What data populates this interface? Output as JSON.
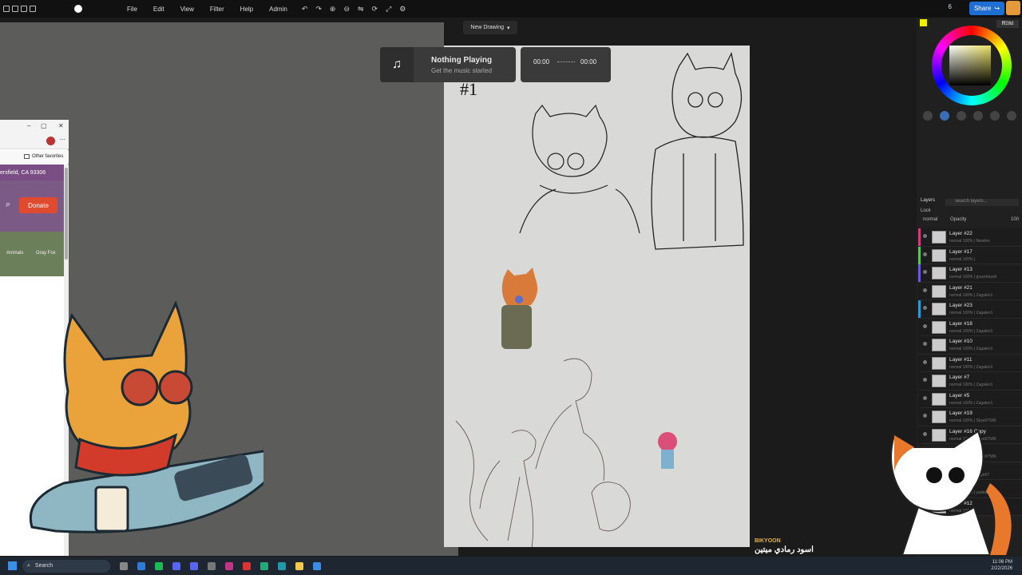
{
  "menu": [
    "File",
    "Edit",
    "View",
    "Filter",
    "Help",
    "Admin"
  ],
  "toolbar_icons": [
    "undo-icon",
    "redo-icon",
    "zoom-in-icon",
    "zoom-out-icon",
    "flip-icon",
    "rotate-icon",
    "fullscreen-icon",
    "settings-icon"
  ],
  "share_label": "Share",
  "viewer_count": "6",
  "document_title": "New Drawing",
  "music": {
    "title": "Nothing Playing",
    "subtitle": "Get the music started",
    "time_start": "00:00",
    "time_end": "00:00"
  },
  "browser": {
    "favorites": "Other favorites",
    "address": "ersfield, CA 93306",
    "donate": "Donate",
    "crumb1": "Animals",
    "crumb2": "Gray Fox"
  },
  "color_hex": "fff28d",
  "layers_panel": {
    "title": "Layers",
    "search_placeholder": "search layers...",
    "lock": "Lock",
    "blend": "normal",
    "opacity_label": "Opacity",
    "opacity": "100"
  },
  "layers": [
    {
      "name": "Layer #22",
      "meta": "normal 100% | Newton",
      "edge": "#d33c7a"
    },
    {
      "name": "Layer #17",
      "meta": "normal 100% |",
      "edge": "#5fc25f"
    },
    {
      "name": "Layer #13",
      "meta": "normal 100% | gracefulash",
      "edge": "#6a5ad8"
    },
    {
      "name": "Layer #21",
      "meta": "normal 100% | Zagalen1",
      "edge": "#1c1c1c"
    },
    {
      "name": "Layer #23",
      "meta": "normal 100% | Zagalen1",
      "edge": "#2e9ad0"
    },
    {
      "name": "Layer #18",
      "meta": "normal 100% | Zagalen1",
      "edge": "#1c1c1c"
    },
    {
      "name": "Layer #10",
      "meta": "normal 100% | Zagalen1",
      "edge": "#1c1c1c"
    },
    {
      "name": "Layer #11",
      "meta": "normal 100% | Zagalen1",
      "edge": "#1c1c1c"
    },
    {
      "name": "Layer #7",
      "meta": "normal 100% | Zagalen1",
      "edge": "#1c1c1c"
    },
    {
      "name": "Layer #5",
      "meta": "normal 100% | Zagalen1",
      "edge": "#1c1c1c"
    },
    {
      "name": "Layer #19",
      "meta": "normal 100% | Skye07586",
      "edge": "#1c1c1c"
    },
    {
      "name": "Layer #16 Copy",
      "meta": "normal 100% | Skye07586",
      "edge": "#1c1c1c"
    },
    {
      "name": "Layer #16",
      "meta": "normal 100% | Skye07586",
      "edge": "#1c1c1c"
    },
    {
      "name": "Layer",
      "meta": "normal 100% | Skye07",
      "edge": "#1c1c1c"
    },
    {
      "name": "Layer",
      "meta": "normal 100% | yadea",
      "edge": "#1c1c1c"
    },
    {
      "name": "Layer #12",
      "meta": "normal 100%",
      "edge": "#1c1c1c"
    }
  ],
  "chat": {
    "user": "BIKYOON",
    "message": "اسود رمادي ميتين"
  },
  "taskbar": {
    "search": "Search"
  },
  "clock": {
    "time": "11:06 PM",
    "date": "2/22/2026"
  },
  "accent": "#1f6ed4"
}
